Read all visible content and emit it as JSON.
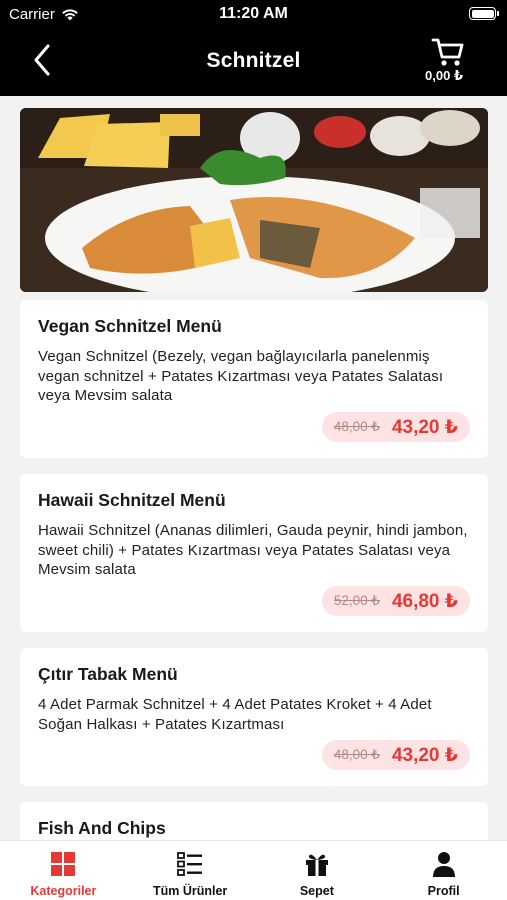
{
  "status_bar": {
    "carrier": "Carrier",
    "time": "11:20 AM"
  },
  "header": {
    "title": "Schnitzel",
    "cart_total": "0,00 ₺"
  },
  "products": [
    {
      "name": "Vegan Schnitzel Menü",
      "description": "Vegan Schnitzel (Bezely, vegan bağlayıcılarla panelenmiş vegan schnitzel + Patates Kızartması veya Patates Salatası veya Mevsim salata",
      "old_price": "48,00 ₺",
      "price": "43,20 ₺"
    },
    {
      "name": "Hawaii Schnitzel Menü",
      "description": "Hawaii Schnitzel (Ananas dilimleri, Gauda peynir, hindi jambon, sweet chili) + Patates Kızartması veya Patates Salatası veya Mevsim salata",
      "old_price": "52,00 ₺",
      "price": "46,80 ₺"
    },
    {
      "name": "Çıtır Tabak Menü",
      "description": "4 Adet Parmak Schnitzel + 4 Adet Patates Kroket + 4 Adet Soğan Halkası + Patates Kızartması",
      "old_price": "48,00 ₺",
      "price": "43,20 ₺"
    },
    {
      "name": "Fish And Chips"
    }
  ],
  "tabbar": {
    "categories": "Kategoriler",
    "all_products": "Tüm Ürünler",
    "basket": "Sepet",
    "profile": "Profil"
  },
  "colors": {
    "accent": "#e53935",
    "price_bg": "#fde3e3",
    "header_bg": "#000000"
  }
}
